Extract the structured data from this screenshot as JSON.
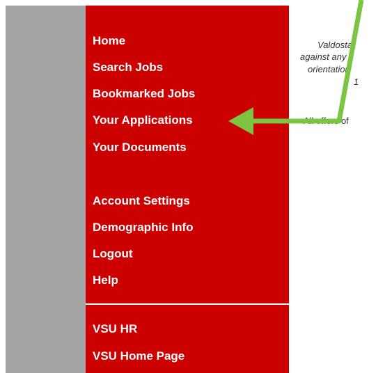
{
  "nav": {
    "items": [
      {
        "label": "Home"
      },
      {
        "label": "Search Jobs"
      },
      {
        "label": "Bookmarked Jobs"
      },
      {
        "label": "Your Applications"
      },
      {
        "label": "Your Documents"
      },
      {
        "label": "Account Settings"
      },
      {
        "label": "Demographic Info"
      },
      {
        "label": "Logout"
      },
      {
        "label": "Help"
      }
    ],
    "external_links": [
      {
        "label": "VSU HR"
      },
      {
        "label": "VSU Home Page"
      }
    ]
  },
  "content": {
    "lines": [
      "Valdosta",
      "against any",
      "orientation",
      "1"
    ],
    "offer_text": "All offers of"
  },
  "colors": {
    "nav_bg": "#cc0000",
    "side_strip": "#a5a5a5",
    "annotation_arrow": "#7dc442"
  }
}
